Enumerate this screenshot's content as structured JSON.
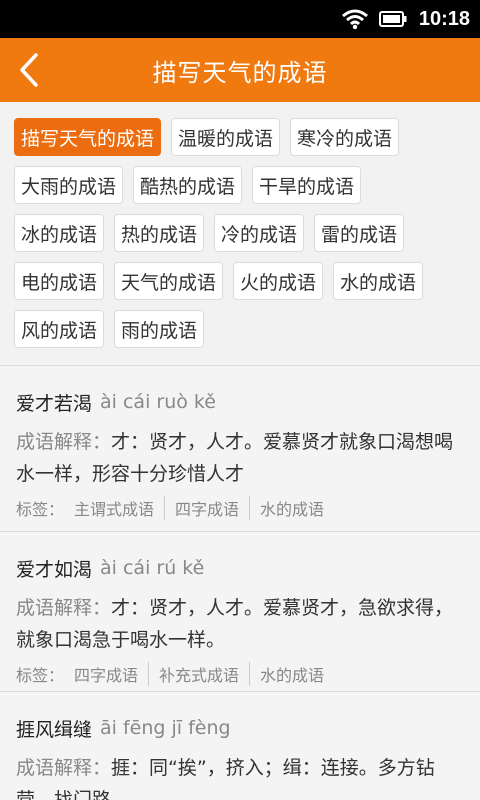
{
  "status": {
    "time": "10:18"
  },
  "header": {
    "title": "描写天气的成语"
  },
  "tags": [
    [
      "描写天气的成语",
      "温暖的成语",
      "寒冷的成语"
    ],
    [
      "大雨的成语",
      "酷热的成语",
      "干旱的成语"
    ],
    [
      "冰的成语",
      "热的成语",
      "冷的成语",
      "雷的成语"
    ],
    [
      "电的成语",
      "天气的成语",
      "火的成语",
      "水的成语"
    ],
    [
      "风的成语",
      "雨的成语"
    ]
  ],
  "active_tag": "描写天气的成语",
  "list": [
    {
      "word": "爱才若渴",
      "pinyin": "ài cái ruò kě",
      "def_label": "成语解释：",
      "definition": "才：贤才，人才。爱慕贤才就象口渴想喝水一样，形容十分珍惜人才",
      "labels_title": "标签：",
      "labels": [
        "主谓式成语",
        "四字成语",
        "水的成语"
      ]
    },
    {
      "word": "爱才如渴",
      "pinyin": "ài cái rú kě",
      "def_label": "成语解释：",
      "definition": "才：贤才，人才。爱慕贤才，急欲求得，就象口渴急于喝水一样。",
      "labels_title": "标签：",
      "labels": [
        "四字成语",
        "补充式成语",
        "水的成语"
      ]
    },
    {
      "word": "捱风缉缝",
      "pinyin": "āi fēng jī fèng",
      "def_label": "成语解释：",
      "definition": "捱：同“挨”，挤入；缉：连接。多方钻营，找门路。"
    }
  ]
}
